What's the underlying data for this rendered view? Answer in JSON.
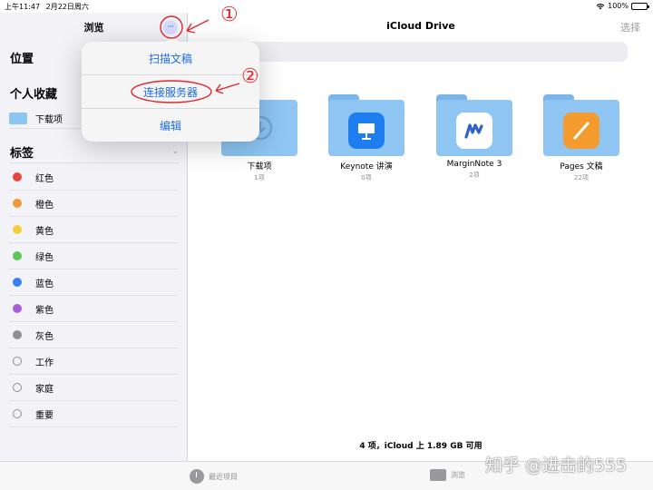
{
  "status": {
    "time": "上午11:47",
    "date": "2月22日周六",
    "battery": "100%",
    "battery_level": 1.0,
    "wifi_icon": "wifi-icon"
  },
  "sidebar": {
    "title": "浏览",
    "more_button": "···",
    "locations_header": "位置",
    "favorites_header": "个人收藏",
    "favorites": [
      {
        "label": "下载项",
        "icon": "folder-icon"
      }
    ],
    "tags_header": "标签",
    "tags": [
      {
        "label": "红色",
        "color": "#e5483d"
      },
      {
        "label": "橙色",
        "color": "#f0993a"
      },
      {
        "label": "黄色",
        "color": "#f5cf3c"
      },
      {
        "label": "绿色",
        "color": "#5cc75a"
      },
      {
        "label": "蓝色",
        "color": "#3a7ff2"
      },
      {
        "label": "紫色",
        "color": "#a95ed9"
      },
      {
        "label": "灰色",
        "color": "#8e8e93"
      },
      {
        "label": "工作",
        "color": ""
      },
      {
        "label": "家庭",
        "color": ""
      },
      {
        "label": "重要",
        "color": ""
      }
    ]
  },
  "popover": {
    "items": [
      {
        "label": "扫描文稿"
      },
      {
        "label": "连接服务器"
      },
      {
        "label": "编辑"
      }
    ]
  },
  "main": {
    "title": "iCloud Drive",
    "select_label": "选择",
    "folders": [
      {
        "name": "下载项",
        "count": "1项",
        "icon": "download-icon"
      },
      {
        "name": "Keynote 讲演",
        "count": "0项",
        "icon": "keynote-app-icon",
        "app_color": "#1e7ef0"
      },
      {
        "name": "MarginNote 3",
        "count": "2项",
        "icon": "marginnote-app-icon",
        "app_color": "#ffffff"
      },
      {
        "name": "Pages 文稿",
        "count": "22项",
        "icon": "pages-app-icon",
        "app_color": "#f39b2f"
      }
    ],
    "storage_text": "4 项，iCloud 上 1.89 GB 可用"
  },
  "tabbar": {
    "recents": "最近项目",
    "browse": "浏览"
  },
  "annotations": {
    "mark1": "①",
    "mark2": "②",
    "color": "#e0282e"
  },
  "watermark": "知乎 @进击的555",
  "colors": {
    "accent": "#1a6ce6",
    "folder": "#8ec5f3"
  }
}
